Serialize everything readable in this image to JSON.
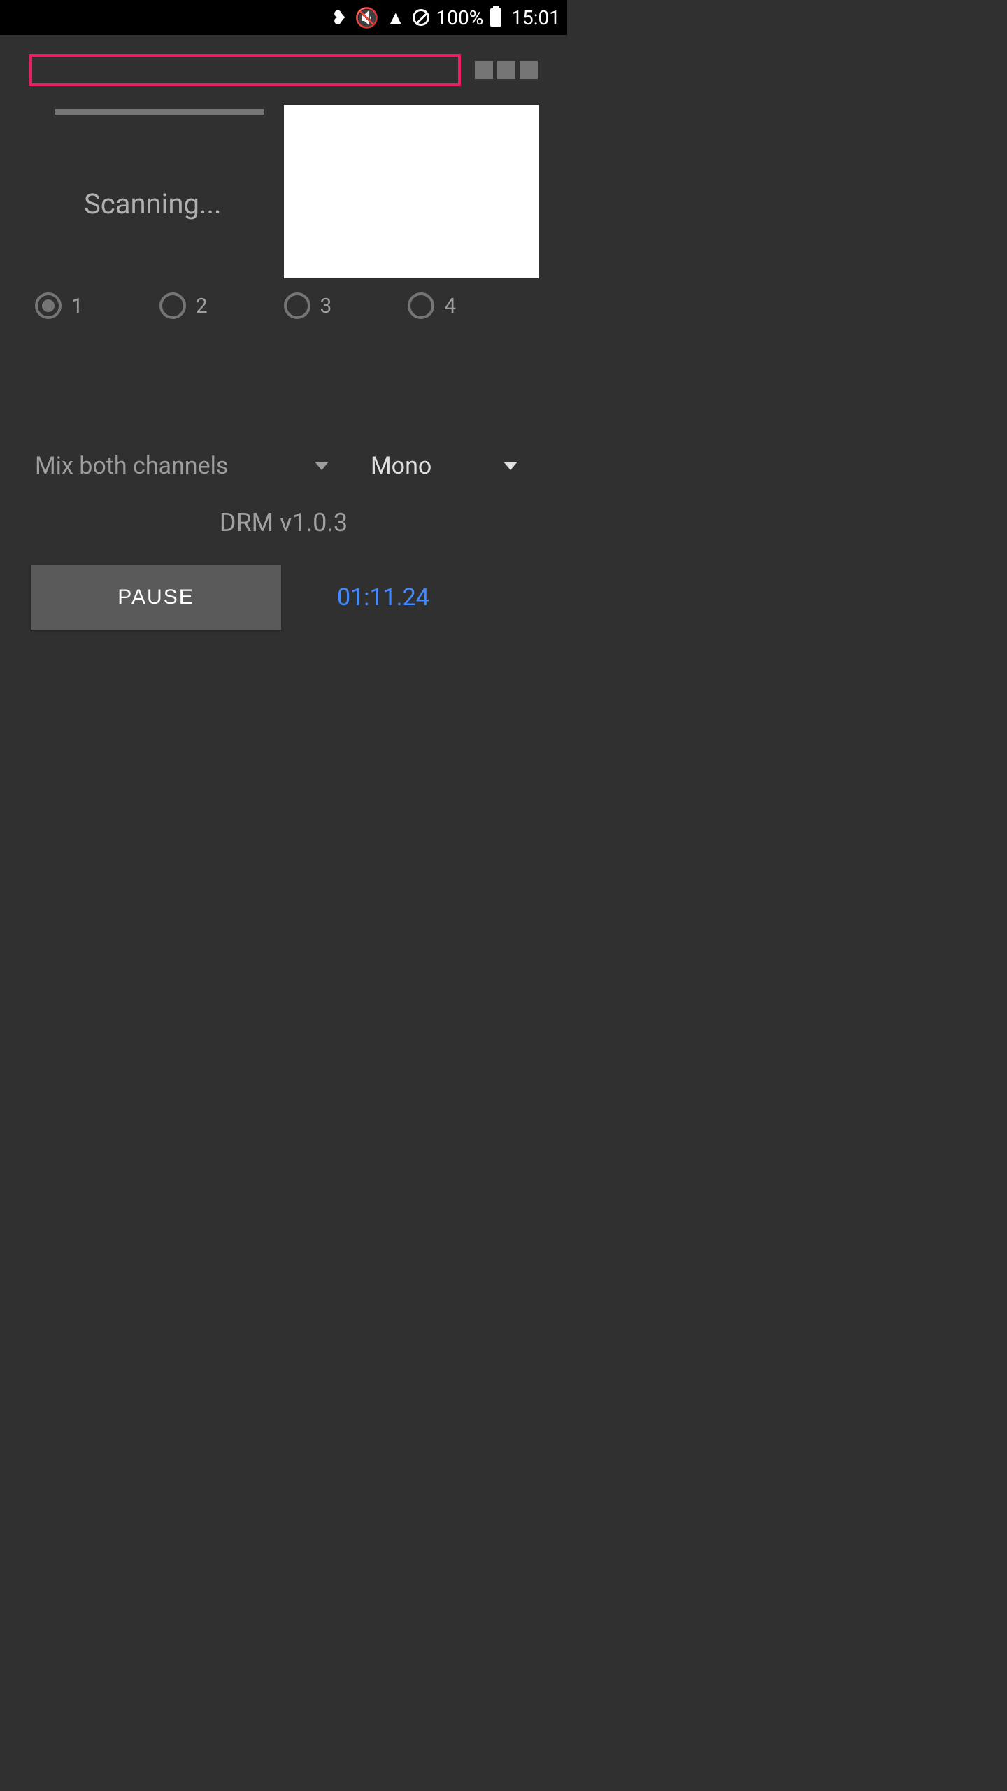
{
  "status_bar": {
    "battery_pct": "100%",
    "time": "15:01",
    "icons": {
      "bluetooth": "bluetooth-icon",
      "mute_vibrate": "mute-vibrate-icon",
      "wifi": "wifi-icon",
      "nodata": "no-data-icon",
      "battery": "battery-full-icon"
    }
  },
  "header": {
    "title": "",
    "signal_bars": 3
  },
  "main": {
    "status": "Scanning...",
    "canvas_fill": "#ffffff"
  },
  "radios": {
    "items": [
      {
        "label": "1",
        "selected": true
      },
      {
        "label": "2",
        "selected": false
      },
      {
        "label": "3",
        "selected": false
      },
      {
        "label": "4",
        "selected": false
      }
    ]
  },
  "selectors": {
    "mix": {
      "label": "Mix both channels"
    },
    "mode": {
      "label": "Mono"
    }
  },
  "version": "DRM v1.0.3",
  "controls": {
    "pause_label": "PAUSE",
    "elapsed": "01:11.24"
  },
  "colors": {
    "accent": "#e91e63",
    "link": "#448aff",
    "bg": "#303030"
  }
}
